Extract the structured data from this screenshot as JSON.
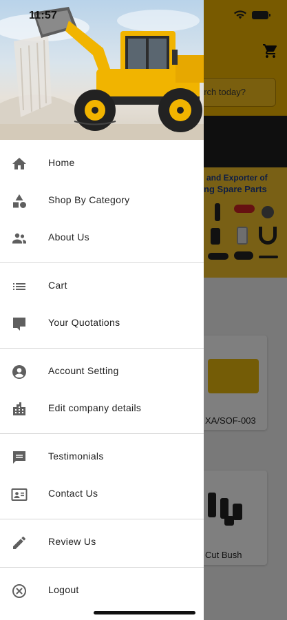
{
  "status_bar": {
    "time": "11:57"
  },
  "background": {
    "search_placeholder": "arch today?",
    "banner_line1": "and Exporter of",
    "banner_line2": "ng Spare Parts",
    "product_1": "XA/SOF-003",
    "product_2": "Cut Bush",
    "accent_color": "#f1b400"
  },
  "drawer": {
    "sections": [
      [
        {
          "label": "Home",
          "icon": "home-icon"
        },
        {
          "label": "Shop By Category",
          "icon": "category-icon"
        },
        {
          "label": "About Us",
          "icon": "people-icon"
        }
      ],
      [
        {
          "label": "Cart",
          "icon": "list-icon"
        },
        {
          "label": "Your Quotations",
          "icon": "quotation-icon"
        }
      ],
      [
        {
          "label": "Account Setting",
          "icon": "account-circle-icon"
        },
        {
          "label": "Edit company details",
          "icon": "company-building-icon"
        }
      ],
      [
        {
          "label": "Testimonials",
          "icon": "message-icon"
        },
        {
          "label": "Contact Us",
          "icon": "contact-card-icon"
        }
      ],
      [
        {
          "label": "Review Us",
          "icon": "pencil-icon"
        }
      ],
      [
        {
          "label": "Logout",
          "icon": "close-circle-icon"
        }
      ]
    ]
  }
}
